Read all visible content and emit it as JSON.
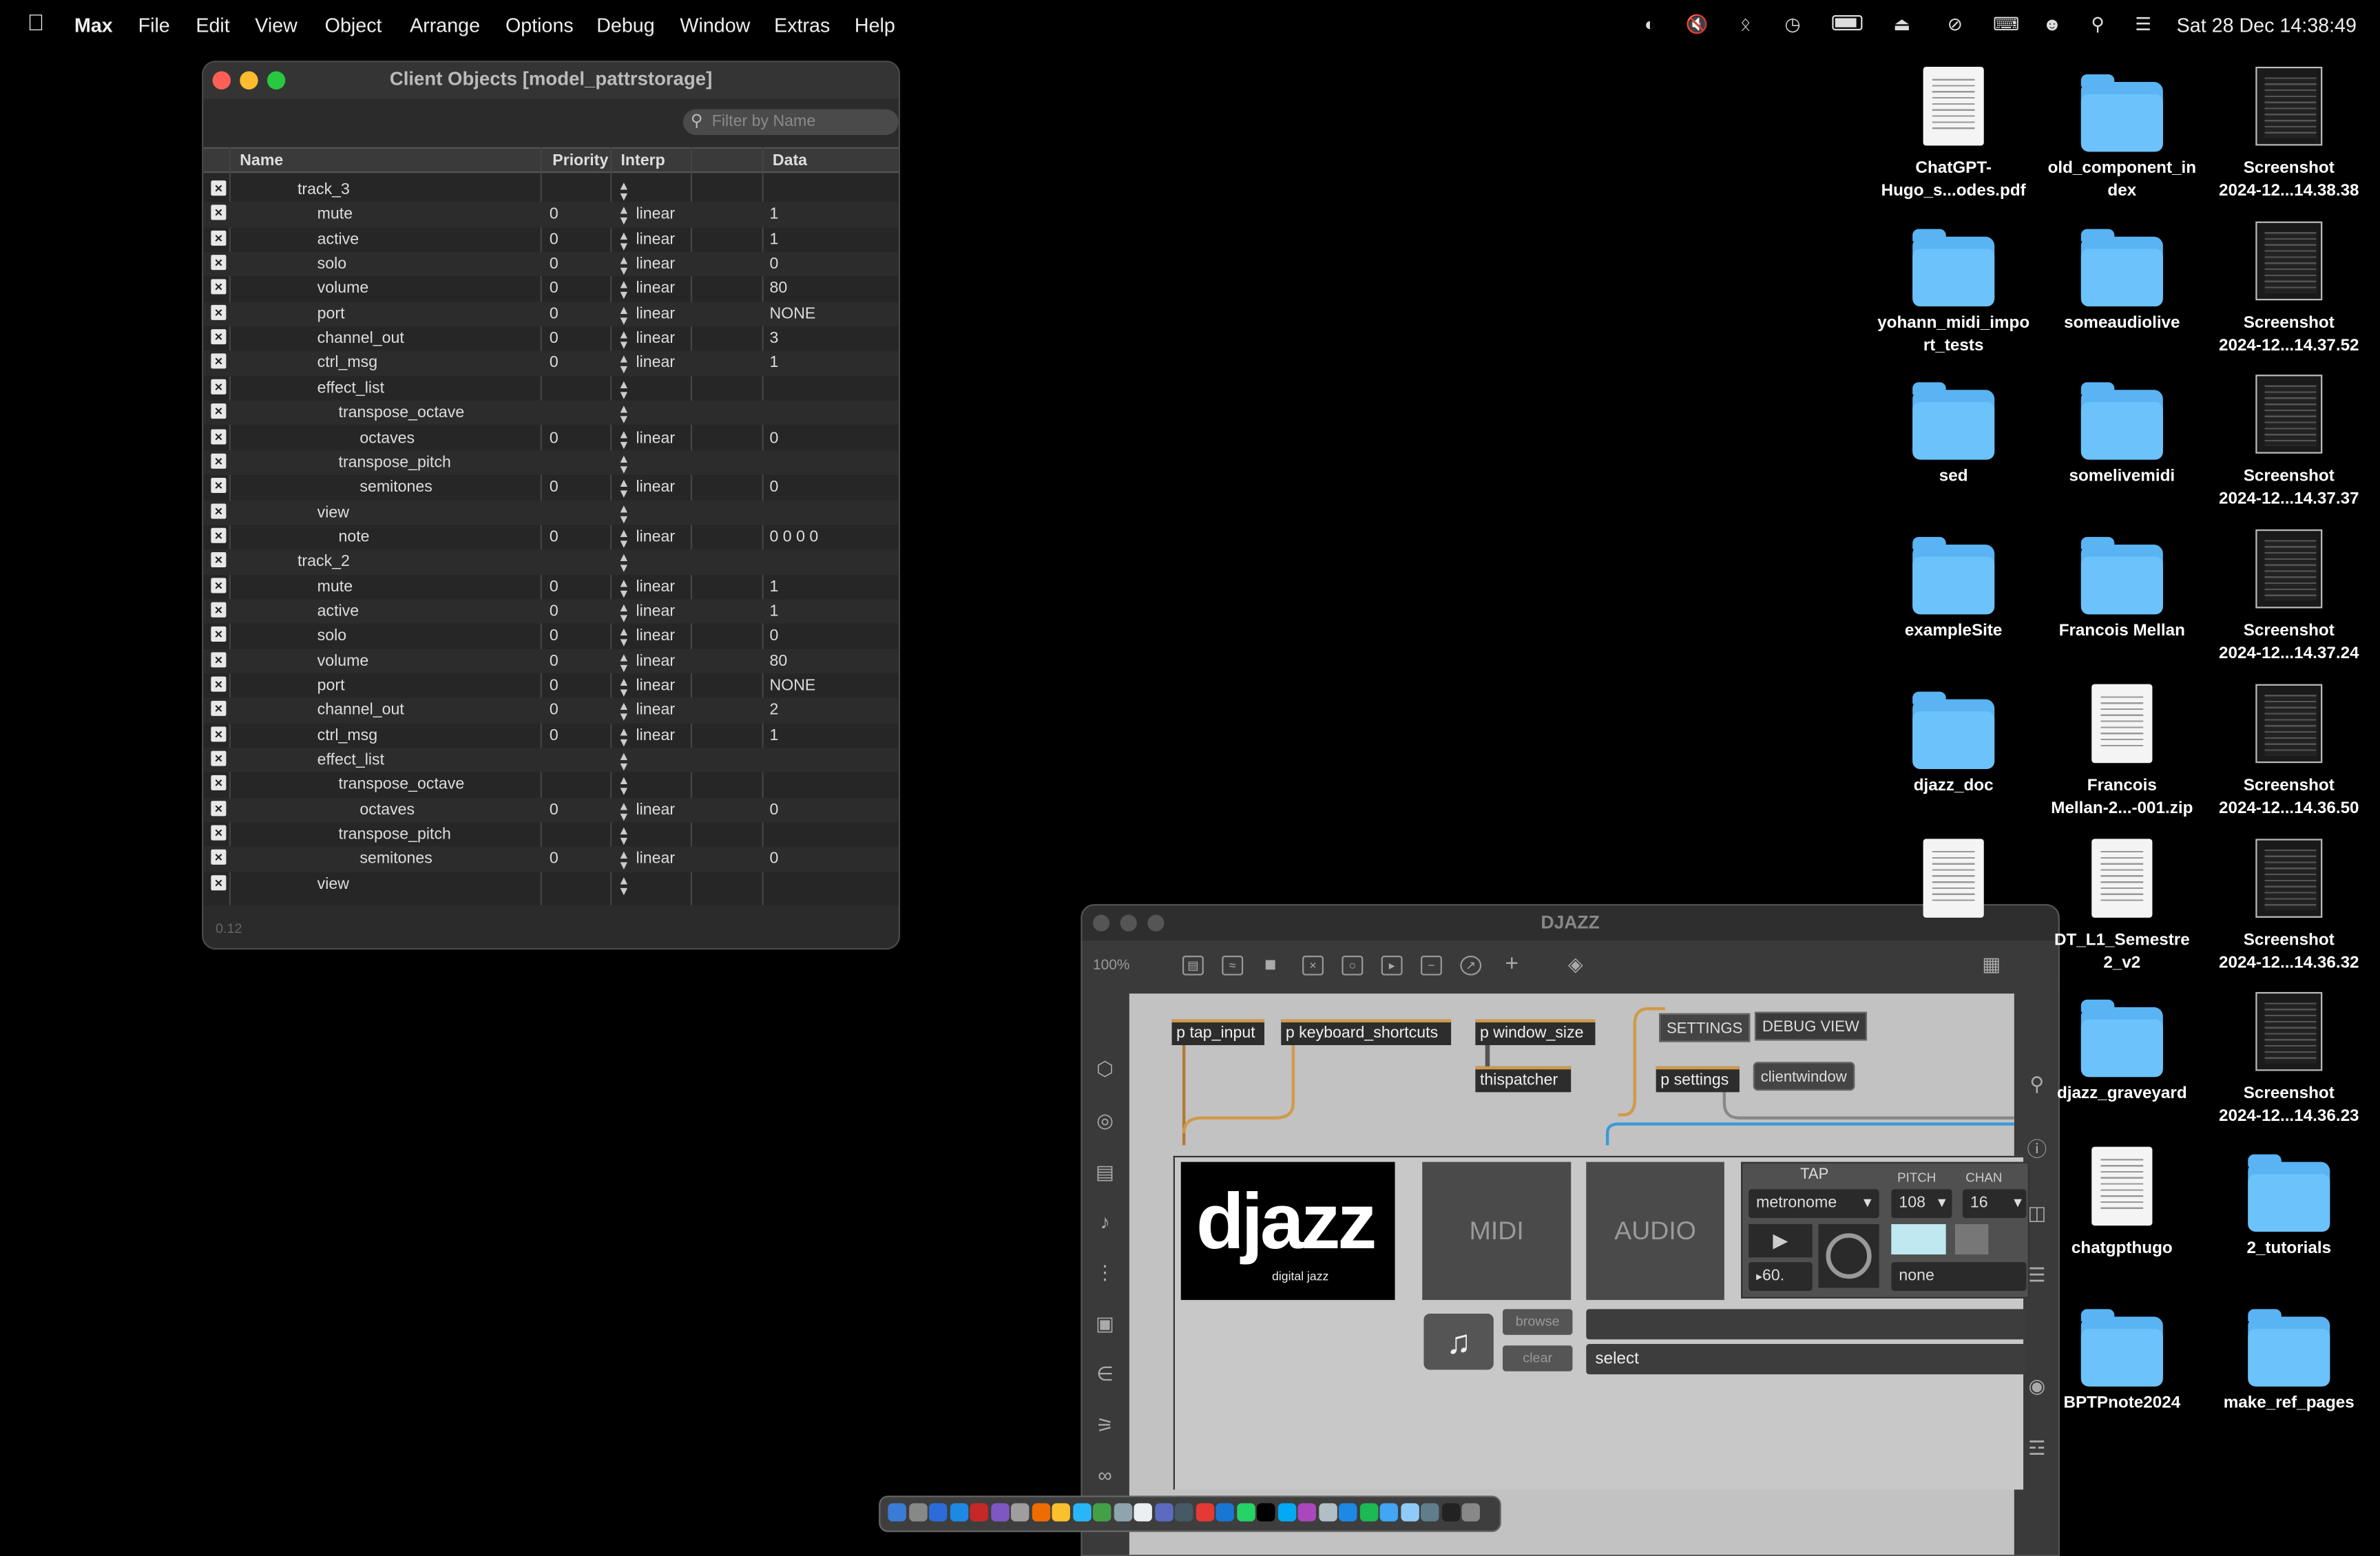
{
  "menubar": {
    "app": "Max",
    "items": [
      "File",
      "Edit",
      "View",
      "Object",
      "Arrange",
      "Options",
      "Debug",
      "Window",
      "Extras",
      "Help"
    ],
    "datetime": "Sat 28 Dec  14:38:49",
    "status_icons": [
      "creative-cloud-icon",
      "mute-icon",
      "bluetooth-icon",
      "time-machine-icon",
      "battery-icon",
      "eject-icon",
      "wifi-off-icon",
      "keyboard-icon",
      "user-icon",
      "search-icon",
      "control-center-icon"
    ]
  },
  "client": {
    "title": "Client Objects [model_pattrstorage]",
    "filter_placeholder": "Filter by Name",
    "columns": {
      "name": "Name",
      "priority": "Priority",
      "interp": "Interp",
      "data": "Data"
    },
    "footer": "0.12",
    "rows": [
      {
        "name": "track_3",
        "indent": 0,
        "priority": "",
        "interp": "",
        "data": ""
      },
      {
        "name": "mute",
        "indent": 1,
        "priority": "0",
        "interp": "linear",
        "data": "1"
      },
      {
        "name": "active",
        "indent": 1,
        "priority": "0",
        "interp": "linear",
        "data": "1"
      },
      {
        "name": "solo",
        "indent": 1,
        "priority": "0",
        "interp": "linear",
        "data": "0"
      },
      {
        "name": "volume",
        "indent": 1,
        "priority": "0",
        "interp": "linear",
        "data": "80"
      },
      {
        "name": "port",
        "indent": 1,
        "priority": "0",
        "interp": "linear",
        "data": "NONE"
      },
      {
        "name": "channel_out",
        "indent": 1,
        "priority": "0",
        "interp": "linear",
        "data": "3"
      },
      {
        "name": "ctrl_msg",
        "indent": 1,
        "priority": "0",
        "interp": "linear",
        "data": "1"
      },
      {
        "name": "effect_list",
        "indent": 1,
        "priority": "",
        "interp": "",
        "data": ""
      },
      {
        "name": "transpose_octave",
        "indent": 2,
        "priority": "",
        "interp": "",
        "data": ""
      },
      {
        "name": "octaves",
        "indent": 3,
        "priority": "0",
        "interp": "linear",
        "data": "0"
      },
      {
        "name": "transpose_pitch",
        "indent": 2,
        "priority": "",
        "interp": "",
        "data": ""
      },
      {
        "name": "semitones",
        "indent": 3,
        "priority": "0",
        "interp": "linear",
        "data": "0"
      },
      {
        "name": "view",
        "indent": 1,
        "priority": "",
        "interp": "",
        "data": ""
      },
      {
        "name": "note",
        "indent": 2,
        "priority": "0",
        "interp": "linear",
        "data": "0 0 0 0"
      },
      {
        "name": "track_2",
        "indent": 0,
        "priority": "",
        "interp": "",
        "data": ""
      },
      {
        "name": "mute",
        "indent": 1,
        "priority": "0",
        "interp": "linear",
        "data": "1"
      },
      {
        "name": "active",
        "indent": 1,
        "priority": "0",
        "interp": "linear",
        "data": "1"
      },
      {
        "name": "solo",
        "indent": 1,
        "priority": "0",
        "interp": "linear",
        "data": "0"
      },
      {
        "name": "volume",
        "indent": 1,
        "priority": "0",
        "interp": "linear",
        "data": "80"
      },
      {
        "name": "port",
        "indent": 1,
        "priority": "0",
        "interp": "linear",
        "data": "NONE"
      },
      {
        "name": "channel_out",
        "indent": 1,
        "priority": "0",
        "interp": "linear",
        "data": "2"
      },
      {
        "name": "ctrl_msg",
        "indent": 1,
        "priority": "0",
        "interp": "linear",
        "data": "1"
      },
      {
        "name": "effect_list",
        "indent": 1,
        "priority": "",
        "interp": "",
        "data": ""
      },
      {
        "name": "transpose_octave",
        "indent": 2,
        "priority": "",
        "interp": "",
        "data": ""
      },
      {
        "name": "octaves",
        "indent": 3,
        "priority": "0",
        "interp": "linear",
        "data": "0"
      },
      {
        "name": "transpose_pitch",
        "indent": 2,
        "priority": "",
        "interp": "",
        "data": ""
      },
      {
        "name": "semitones",
        "indent": 3,
        "priority": "0",
        "interp": "linear",
        "data": "0"
      },
      {
        "name": "view",
        "indent": 1,
        "priority": "",
        "interp": "",
        "data": ""
      }
    ]
  },
  "djazz": {
    "title": "DJAZZ",
    "zoom": "100%",
    "objects": {
      "tap_input": "p tap_input",
      "keyboard_shortcuts": "p keyboard_shortcuts",
      "window_size": "p window_size",
      "thispatcher": "thispatcher",
      "settings_msg": "SETTINGS",
      "debug_view": "DEBUG VIEW",
      "p_settings": "p settings",
      "clientwindow": "clientwindow"
    },
    "panel": {
      "logo": "djazz",
      "logo_sub": "digital jazz",
      "midi": "MIDI",
      "audio": "AUDIO",
      "tap": "TAP",
      "pitch": "PITCH",
      "chan": "CHAN",
      "metronome": "metronome",
      "pitch_val": "108",
      "chan_val": "16",
      "tempo": "60.",
      "none": "none",
      "browse": "browse",
      "clear": "clear",
      "select": "select"
    }
  },
  "desktop": [
    {
      "label": "ChatGPT-\nHugo_s...odes.pdf",
      "kind": "doc"
    },
    {
      "label": "old_component_in\ndex",
      "kind": "folder"
    },
    {
      "label": "Screenshot\n2024-12...14.38.38",
      "kind": "shot"
    },
    {
      "label": "yohann_midi_impo\nrt_tests",
      "kind": "folder"
    },
    {
      "label": "someaudiolive",
      "kind": "folder"
    },
    {
      "label": "Screenshot\n2024-12...14.37.52",
      "kind": "shot"
    },
    {
      "label": "sed",
      "kind": "folder"
    },
    {
      "label": "somelivemidi",
      "kind": "folder"
    },
    {
      "label": "Screenshot\n2024-12...14.37.37",
      "kind": "shot"
    },
    {
      "label": "exampleSite",
      "kind": "folder"
    },
    {
      "label": "Francois Mellan",
      "kind": "folder"
    },
    {
      "label": "Screenshot\n2024-12...14.37.24",
      "kind": "shot"
    },
    {
      "label": "djazz_doc",
      "kind": "folder"
    },
    {
      "label": "Francois\nMellan-2...-001.zip",
      "kind": "zip"
    },
    {
      "label": "Screenshot\n2024-12...14.36.50",
      "kind": "shot"
    },
    {
      "label": "",
      "kind": "doc"
    },
    {
      "label": "DT_L1_Semestre\n2_v2",
      "kind": "doc"
    },
    {
      "label": "Screenshot\n2024-12...14.36.32",
      "kind": "shot"
    },
    {
      "label": "",
      "kind": "none"
    },
    {
      "label": "djazz_graveyard",
      "kind": "folder"
    },
    {
      "label": "Screenshot\n2024-12...14.36.23",
      "kind": "shot"
    },
    {
      "label": "",
      "kind": "none"
    },
    {
      "label": "chatgpthugo",
      "kind": "doc"
    },
    {
      "label": "2_tutorials",
      "kind": "folder"
    },
    {
      "label": "",
      "kind": "none"
    },
    {
      "label": "BPTPnote2024",
      "kind": "folder"
    },
    {
      "label": "make_ref_pages",
      "kind": "folder"
    }
  ],
  "colors": {
    "accent": "#5ab4f4",
    "patch_cord": "#d09a4a",
    "close": "#ff5f57",
    "minimize": "#febc2e",
    "zoom": "#28c840"
  }
}
